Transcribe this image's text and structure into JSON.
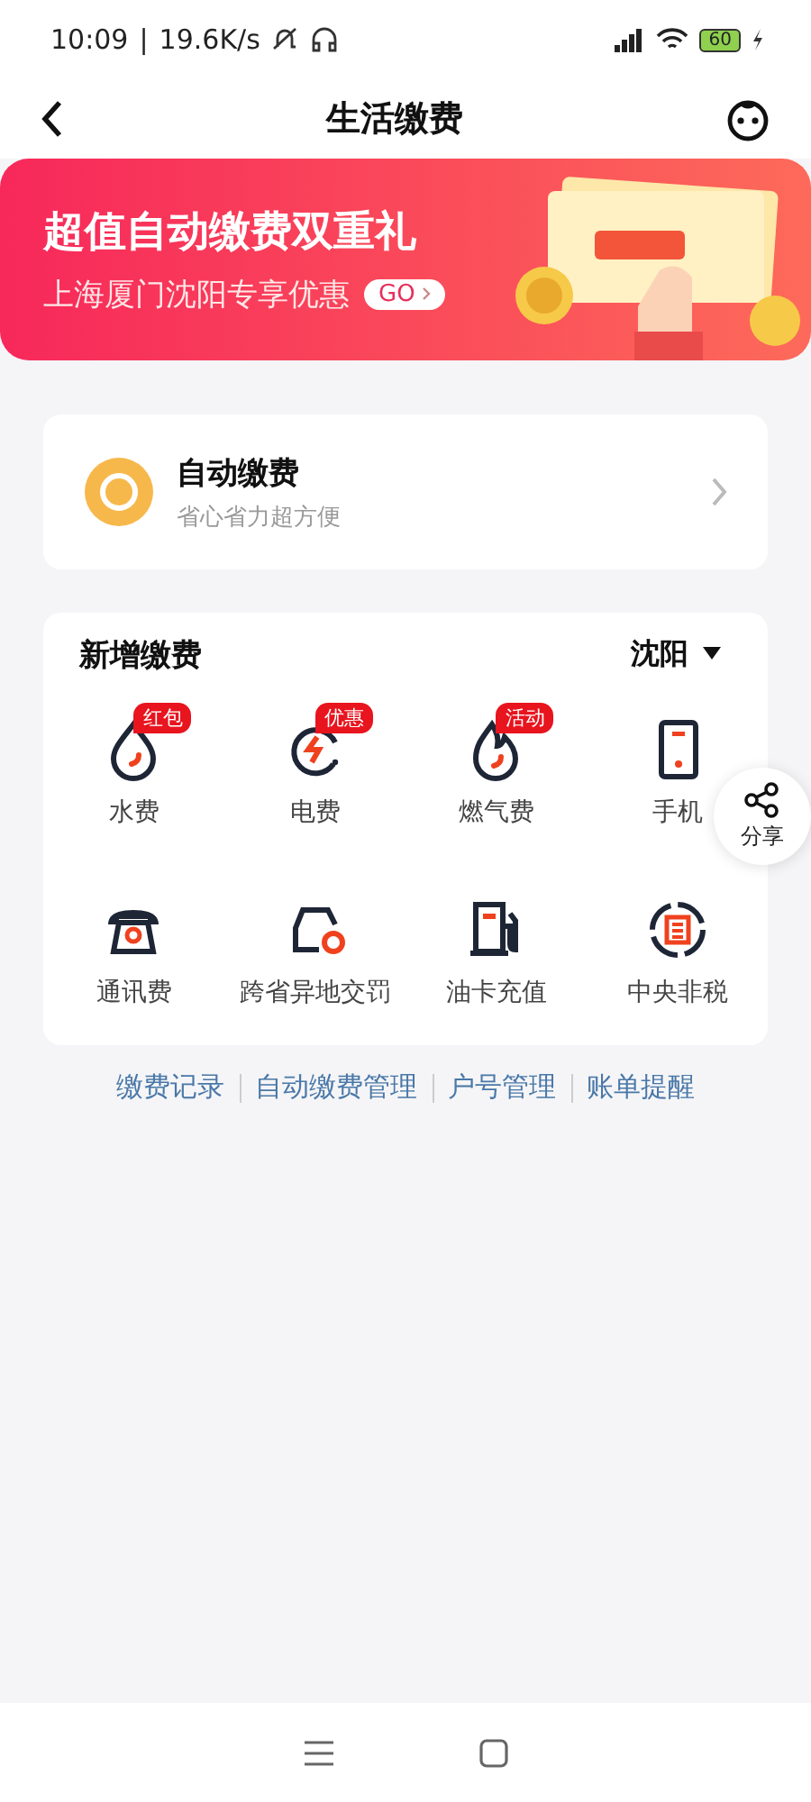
{
  "status_bar": {
    "time": "10:09",
    "separator": "|",
    "speed": "19.6K/s",
    "battery": "60"
  },
  "header": {
    "title": "生活缴费"
  },
  "banner": {
    "title": "超值自动缴费双重礼",
    "subtitle": "上海厦门沈阳专享优惠",
    "button": "GO"
  },
  "auto_pay": {
    "title": "自动缴费",
    "subtitle": "省心省力超方便"
  },
  "new_payment": {
    "title": "新增缴费",
    "city": "沈阳",
    "items": [
      {
        "kind": "water",
        "label": "水费",
        "badge": "红包"
      },
      {
        "kind": "power",
        "label": "电费",
        "badge": "优惠"
      },
      {
        "kind": "gas",
        "label": "燃气费",
        "badge": "活动"
      },
      {
        "kind": "phone",
        "label": "手机"
      },
      {
        "kind": "telephone",
        "label": "通讯费"
      },
      {
        "kind": "car",
        "label": "跨省异地交罚"
      },
      {
        "kind": "fuel",
        "label": "油卡充值"
      },
      {
        "kind": "tax",
        "label": "中央非税"
      }
    ]
  },
  "share": {
    "label": "分享"
  },
  "links": [
    "缴费记录",
    "自动缴费管理",
    "户号管理",
    "账单提醒"
  ]
}
